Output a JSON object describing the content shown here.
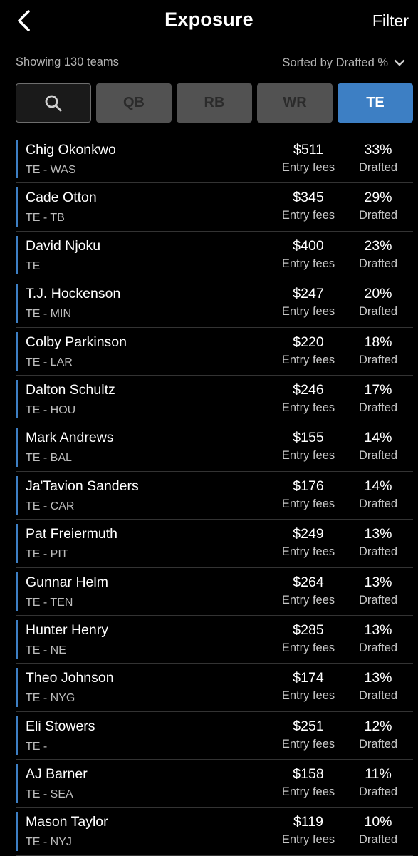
{
  "header": {
    "title": "Exposure",
    "filter_label": "Filter",
    "back_icon": "chevron-left-icon"
  },
  "summary": {
    "showing": "Showing 130 teams",
    "sorted": "Sorted by Drafted %"
  },
  "colors": {
    "accent": "#3d7fc4",
    "background": "#000000",
    "inactive_tab": "#525252"
  },
  "position_filters": {
    "search_icon": "search-icon",
    "tabs": [
      {
        "label": "QB",
        "active": false
      },
      {
        "label": "RB",
        "active": false
      },
      {
        "label": "WR",
        "active": false
      },
      {
        "label": "TE",
        "active": true
      }
    ]
  },
  "players": [
    {
      "name": "Chig Okonkwo",
      "position": "TE - WAS",
      "fees": "$511",
      "fees_label": "Entry fees",
      "drafted": "33%",
      "drafted_label": "Drafted"
    },
    {
      "name": "Cade Otton",
      "position": "TE - TB",
      "fees": "$345",
      "fees_label": "Entry fees",
      "drafted": "29%",
      "drafted_label": "Drafted"
    },
    {
      "name": "David Njoku",
      "position": "TE",
      "fees": "$400",
      "fees_label": "Entry fees",
      "drafted": "23%",
      "drafted_label": "Drafted"
    },
    {
      "name": "T.J. Hockenson",
      "position": "TE - MIN",
      "fees": "$247",
      "fees_label": "Entry fees",
      "drafted": "20%",
      "drafted_label": "Drafted"
    },
    {
      "name": "Colby Parkinson",
      "position": "TE - LAR",
      "fees": "$220",
      "fees_label": "Entry fees",
      "drafted": "18%",
      "drafted_label": "Drafted"
    },
    {
      "name": "Dalton Schultz",
      "position": "TE - HOU",
      "fees": "$246",
      "fees_label": "Entry fees",
      "drafted": "17%",
      "drafted_label": "Drafted"
    },
    {
      "name": "Mark Andrews",
      "position": "TE - BAL",
      "fees": "$155",
      "fees_label": "Entry fees",
      "drafted": "14%",
      "drafted_label": "Drafted"
    },
    {
      "name": "Ja'Tavion Sanders",
      "position": "TE - CAR",
      "fees": "$176",
      "fees_label": "Entry fees",
      "drafted": "14%",
      "drafted_label": "Drafted"
    },
    {
      "name": "Pat Freiermuth",
      "position": "TE - PIT",
      "fees": "$249",
      "fees_label": "Entry fees",
      "drafted": "13%",
      "drafted_label": "Drafted"
    },
    {
      "name": "Gunnar Helm",
      "position": "TE - TEN",
      "fees": "$264",
      "fees_label": "Entry fees",
      "drafted": "13%",
      "drafted_label": "Drafted"
    },
    {
      "name": "Hunter Henry",
      "position": "TE - NE",
      "fees": "$285",
      "fees_label": "Entry fees",
      "drafted": "13%",
      "drafted_label": "Drafted"
    },
    {
      "name": "Theo Johnson",
      "position": "TE - NYG",
      "fees": "$174",
      "fees_label": "Entry fees",
      "drafted": "13%",
      "drafted_label": "Drafted"
    },
    {
      "name": "Eli Stowers",
      "position": "TE -",
      "fees": "$251",
      "fees_label": "Entry fees",
      "drafted": "12%",
      "drafted_label": "Drafted"
    },
    {
      "name": "AJ Barner",
      "position": "TE - SEA",
      "fees": "$158",
      "fees_label": "Entry fees",
      "drafted": "11%",
      "drafted_label": "Drafted"
    },
    {
      "name": "Mason Taylor",
      "position": "TE - NYJ",
      "fees": "$119",
      "fees_label": "Entry fees",
      "drafted": "10%",
      "drafted_label": "Drafted"
    }
  ]
}
